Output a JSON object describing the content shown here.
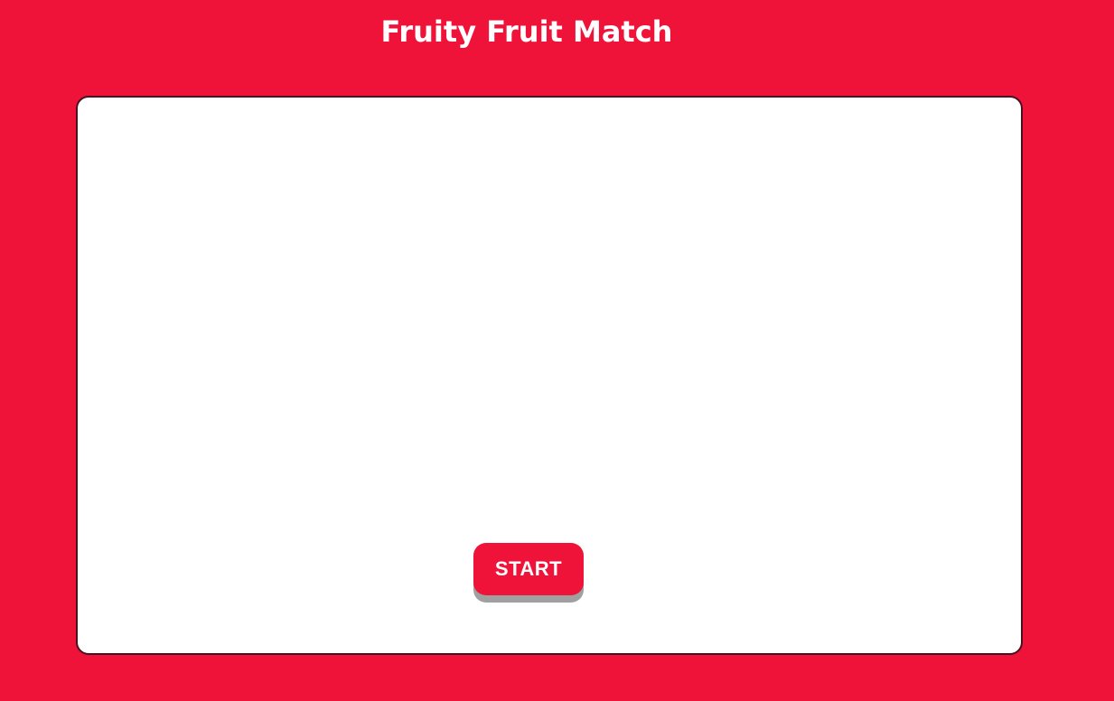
{
  "header": {
    "title": "Fruity Fruit Match"
  },
  "game_board": {
    "start_label": "START"
  },
  "colors": {
    "background": "#EF1239",
    "board": "#FFFFFF",
    "button": "#EF1239",
    "button_text": "#FFFFFF"
  }
}
